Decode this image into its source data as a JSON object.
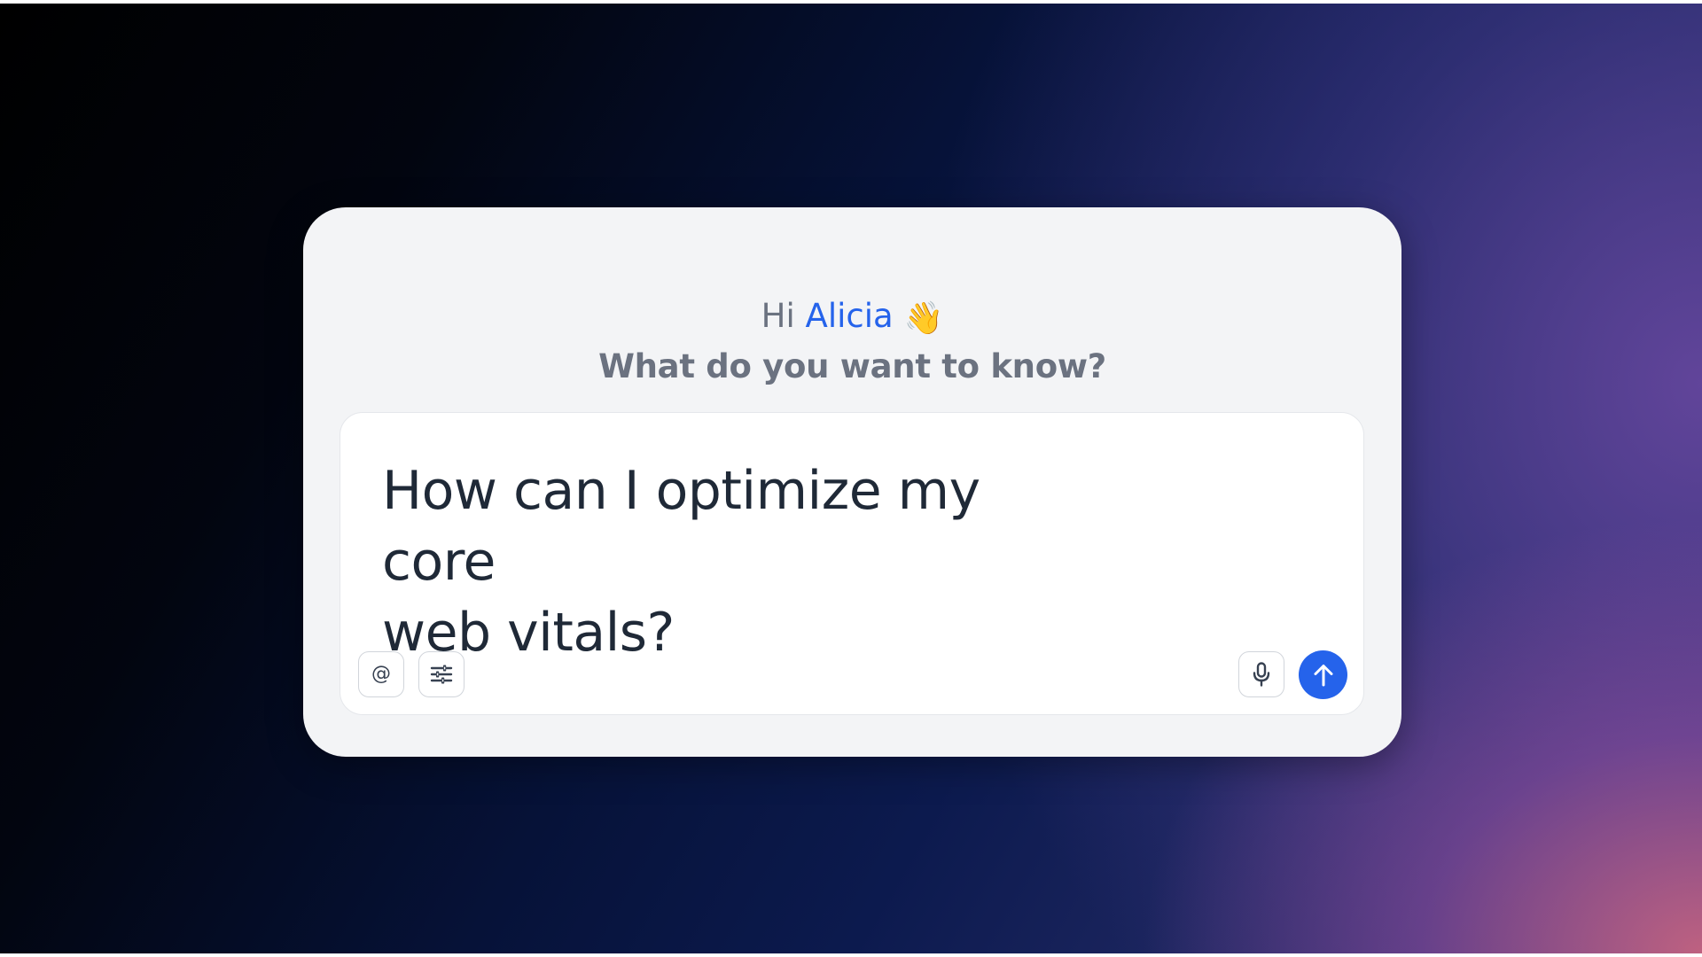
{
  "greeting": {
    "prefix": "Hi",
    "user_name": "Alicia",
    "emoji": "👋"
  },
  "subtitle": "What do you want to know?",
  "input": {
    "value_line1": "How can I optimize my core",
    "value_line2": "web vitals?"
  },
  "toolbar": {
    "mention_symbol": "@",
    "mention_icon": "at-icon",
    "settings_icon": "sliders-icon",
    "mic_icon": "microphone-icon",
    "send_icon": "arrow-up-icon"
  },
  "colors": {
    "accent": "#2563eb",
    "card_bg": "#f3f4f6",
    "muted_text": "#6b7280",
    "query_text": "#1f2937"
  }
}
